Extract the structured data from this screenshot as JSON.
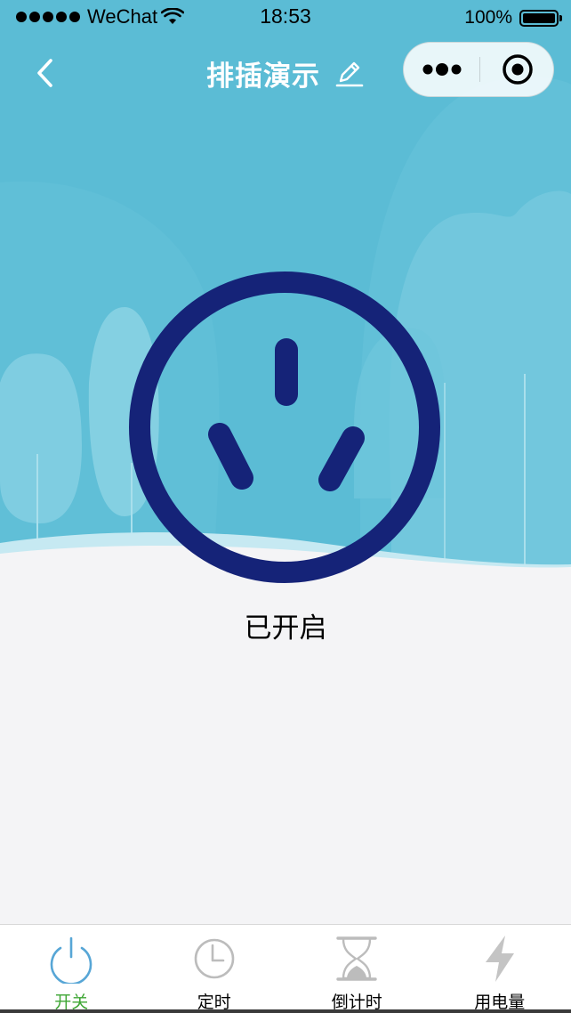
{
  "status_bar": {
    "carrier": "WeChat",
    "time": "18:53",
    "battery": "100%"
  },
  "nav": {
    "title": "排插演示",
    "back_icon": "chevron-left-icon",
    "edit_icon": "pencil-icon",
    "more_icon": "more-dots-icon",
    "close_icon": "target-close-icon"
  },
  "device": {
    "icon": "power-socket-icon",
    "state_label": "已开启"
  },
  "tabs": [
    {
      "label": "开关",
      "icon": "power-icon",
      "active": true
    },
    {
      "label": "定时",
      "icon": "clock-icon",
      "active": false
    },
    {
      "label": "倒计时",
      "icon": "hourglass-icon",
      "active": false
    },
    {
      "label": "用电量",
      "icon": "lightning-icon",
      "active": false
    }
  ],
  "colors": {
    "hero_sky": "#5bbcd5",
    "socket_stroke": "#152378",
    "page_background": "#f4f4f6",
    "tab_active_icon": "#57a6d6",
    "tab_active_label": "#3ea634",
    "tab_inactive_icon": "#bcbcbc"
  }
}
